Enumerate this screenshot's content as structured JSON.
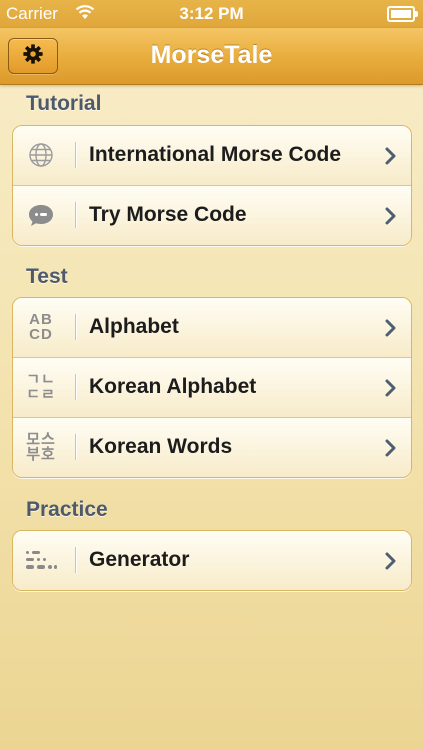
{
  "status_bar": {
    "carrier": "Carrier",
    "time": "3:12 PM"
  },
  "nav": {
    "title": "MorseTale"
  },
  "sections": [
    {
      "header": "Tutorial",
      "items": [
        {
          "label": "International Morse Code",
          "icon": "globe-icon"
        },
        {
          "label": "Try Morse Code",
          "icon": "speech-bubble-icon"
        }
      ]
    },
    {
      "header": "Test",
      "items": [
        {
          "label": "Alphabet",
          "icon": "abcd-icon",
          "icon_text": [
            "AB",
            "CD"
          ]
        },
        {
          "label": "Korean Alphabet",
          "icon": "hangul-icon",
          "icon_text": [
            "ㄱㄴ",
            "ㄷㄹ"
          ]
        },
        {
          "label": "Korean Words",
          "icon": "hangul-words-icon",
          "icon_text": [
            "모스",
            "부호"
          ]
        }
      ]
    },
    {
      "header": "Practice",
      "items": [
        {
          "label": "Generator",
          "icon": "morse-dots-icon"
        }
      ]
    }
  ]
}
